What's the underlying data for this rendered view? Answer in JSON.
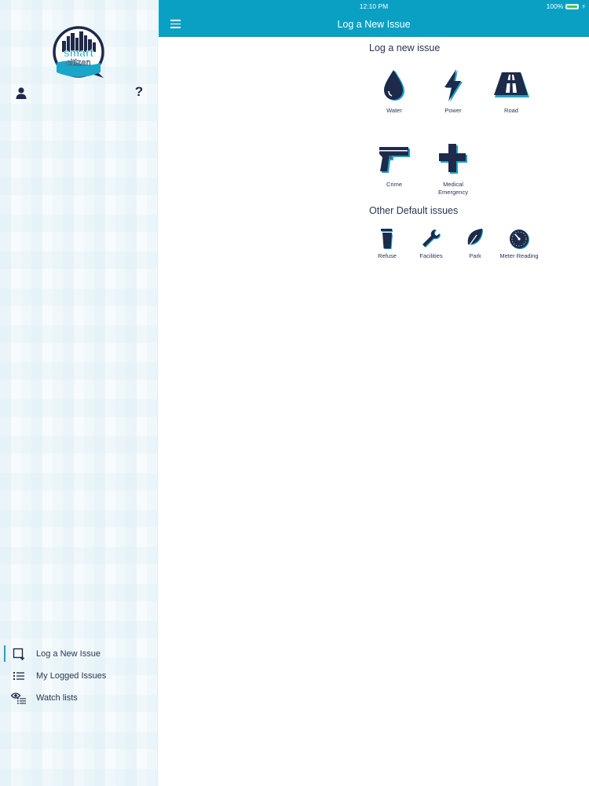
{
  "status_bar": {
    "time": "12:10 PM",
    "battery": "100%"
  },
  "header": {
    "title": "Log a New Issue"
  },
  "sidebar": {
    "logo": {
      "word1": "smart",
      "word2": "citizen"
    },
    "help_label": "?",
    "nav": [
      {
        "label": "Log a New Issue",
        "icon": "add-issue-icon",
        "active": true
      },
      {
        "label": "My Logged Issues",
        "icon": "list-icon",
        "active": false
      },
      {
        "label": "Watch lists",
        "icon": "eye-list-icon",
        "active": false
      }
    ]
  },
  "main": {
    "new_issue_title": "Log a new issue",
    "categories": [
      {
        "label": "Water",
        "icon": "water-drop-icon"
      },
      {
        "label": "Power",
        "icon": "lightning-icon"
      },
      {
        "label": "Road",
        "icon": "road-icon"
      },
      {
        "label": "Crime",
        "icon": "gun-icon"
      },
      {
        "label": "Medical Emergency",
        "label_line1": "Medical",
        "label_line2": "Emergency",
        "icon": "medical-cross-icon"
      }
    ],
    "default_title": "Other Default issues",
    "defaults": [
      {
        "label": "Refuse",
        "icon": "trash-icon"
      },
      {
        "label": "Facilities",
        "icon": "wrench-icon"
      },
      {
        "label": "Park",
        "icon": "leaf-icon"
      },
      {
        "label": "Meter Reading",
        "icon": "meter-icon"
      }
    ]
  },
  "colors": {
    "accent": "#0aa0c4",
    "icon_navy": "#1e2a4a",
    "icon_teal": "#1aa6c9"
  }
}
